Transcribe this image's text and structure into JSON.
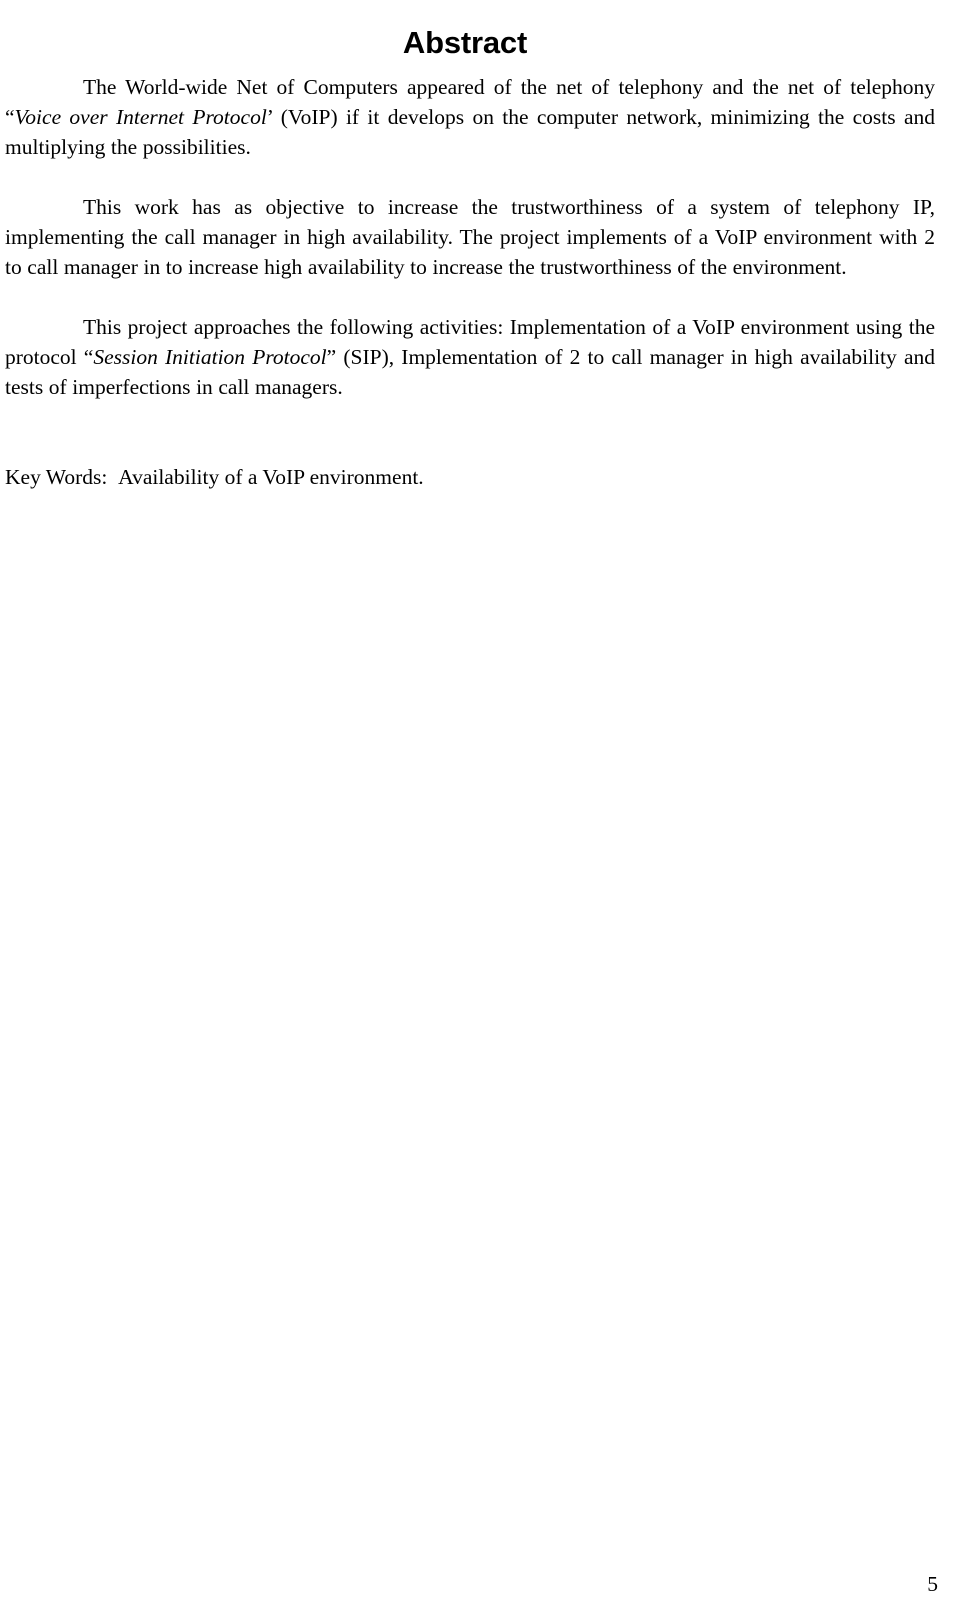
{
  "document": {
    "title": "Abstract",
    "page_number": "5",
    "paragraphs": [
      {
        "id": "p1",
        "segments": [
          {
            "text": "The World-wide Net of Computers appeared of the net of telephony and the net of telephony “",
            "style": "normal"
          },
          {
            "text": "Voice over Internet Protocol",
            "style": "italic"
          },
          {
            "text": "’ (VoIP) if it develops on the computer network, minimizing the costs and multiplying the possibilities.",
            "style": "normal"
          }
        ]
      },
      {
        "id": "p2",
        "segments": [
          {
            "text": "This work has as objective to increase the trustworthiness of a system of telephony IP, implementing the call manager in high availability.  The project implements of a VoIP environment with 2 to call manager in to increase high availability to increase the trustworthiness of the environment.",
            "style": "normal"
          }
        ]
      },
      {
        "id": "p3",
        "segments": [
          {
            "text": "This project approaches the following activities:  Implementation of a VoIP environment using the protocol “",
            "style": "normal"
          },
          {
            "text": "Session Initiation Protocol",
            "style": "italic"
          },
          {
            "text": "” (SIP), Implementation of 2 to call manager in high availability and tests of imperfections in call managers.",
            "style": "normal"
          }
        ]
      }
    ],
    "keywords_line": {
      "label": "Key Words:",
      "value": "Availability of a VoIP environment.",
      "full_text": "Key Words:  Availability of a VoIP environment."
    }
  }
}
